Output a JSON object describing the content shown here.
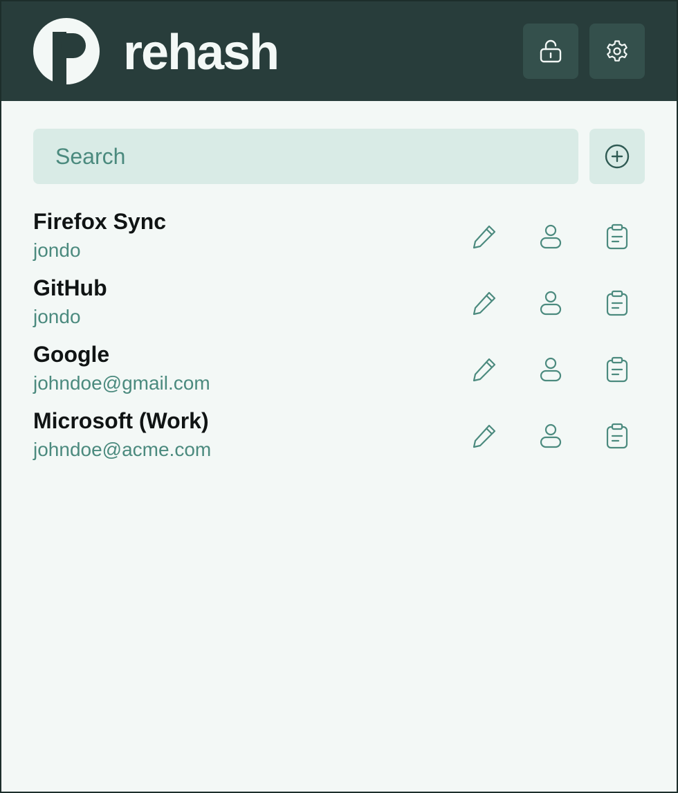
{
  "app": {
    "brand": "rehash"
  },
  "header": {
    "lock_icon": "unlocked-padlock-icon",
    "settings_icon": "gear-icon"
  },
  "search": {
    "placeholder": "Search",
    "value": ""
  },
  "add_button_icon": "plus-circle-icon",
  "entries": [
    {
      "name": "Firefox Sync",
      "username": "jondo"
    },
    {
      "name": "GitHub",
      "username": "jondo"
    },
    {
      "name": "Google",
      "username": "johndoe@gmail.com"
    },
    {
      "name": "Microsoft (Work)",
      "username": "johndoe@acme.com"
    }
  ],
  "row_action_icons": [
    "pencil-icon",
    "user-icon",
    "clipboard-icon"
  ],
  "colors": {
    "header_bg": "#283d3b",
    "header_button_bg": "#34504c",
    "page_bg": "#f3f8f6",
    "search_bg": "#d9ebe6",
    "accent": "#4b8a7e",
    "text": "#101414"
  }
}
